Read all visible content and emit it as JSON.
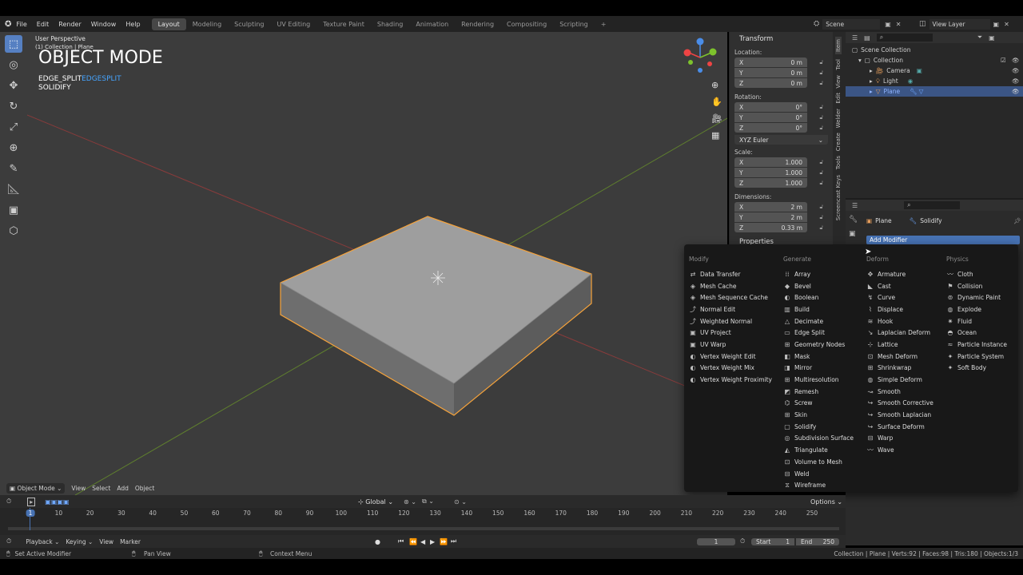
{
  "topbar": {
    "menus": [
      "File",
      "Edit",
      "Render",
      "Window",
      "Help"
    ],
    "workspaces": [
      "Layout",
      "Modeling",
      "Sculpting",
      "UV Editing",
      "Texture Paint",
      "Shading",
      "Animation",
      "Rendering",
      "Compositing",
      "Scripting"
    ],
    "active_workspace": "Layout",
    "add_tab": "+",
    "scene": "Scene",
    "view_layer": "View Layer"
  },
  "viewport": {
    "perspective": "User Perspective",
    "collection_label": "(1) Collection | Plane",
    "mode_overlay": "OBJECT MODE",
    "modifier_line1_a": "EDGE_SPLIT",
    "modifier_line1_b": "EDGESPLIT",
    "modifier_line2": "SOLIDIFY",
    "header": {
      "mode": "Object Mode",
      "view": "View",
      "select": "Select",
      "add": "Add",
      "object": "Object"
    },
    "gizmo": {
      "x": "X",
      "y": "Y",
      "z": "Z"
    }
  },
  "transform_panel": {
    "title": "Transform",
    "location_label": "Location:",
    "location": [
      {
        "axis": "X",
        "value": "0 m"
      },
      {
        "axis": "Y",
        "value": "0 m"
      },
      {
        "axis": "Z",
        "value": "0 m"
      }
    ],
    "rotation_label": "Rotation:",
    "rotation": [
      {
        "axis": "X",
        "value": "0°"
      },
      {
        "axis": "Y",
        "value": "0°"
      },
      {
        "axis": "Z",
        "value": "0°"
      }
    ],
    "rotation_mode": "XYZ Euler",
    "scale_label": "Scale:",
    "scale": [
      {
        "axis": "X",
        "value": "1.000"
      },
      {
        "axis": "Y",
        "value": "1.000"
      },
      {
        "axis": "Z",
        "value": "1.000"
      }
    ],
    "dimensions_label": "Dimensions:",
    "dimensions": [
      {
        "axis": "X",
        "value": "2 m"
      },
      {
        "axis": "Y",
        "value": "2 m"
      },
      {
        "axis": "Z",
        "value": "0.33 m"
      }
    ],
    "properties_label": "Properties"
  },
  "side_tabs": [
    "Item",
    "Tool",
    "View",
    "Edit",
    "Welder",
    "Create",
    "Tools",
    "Screencast Keys"
  ],
  "outliner": {
    "scene_collection": "Scene Collection",
    "collection": "Collection",
    "items": [
      "Camera",
      "Light",
      "Plane"
    ]
  },
  "properties": {
    "object": "Plane",
    "modifier": "Solidify",
    "add_modifier": "Add Modifier"
  },
  "add_modifier_menu": {
    "columns": [
      {
        "header": "Modify",
        "items": [
          "Data Transfer",
          "Mesh Cache",
          "Mesh Sequence Cache",
          "Normal Edit",
          "Weighted Normal",
          "UV Project",
          "UV Warp",
          "Vertex Weight Edit",
          "Vertex Weight Mix",
          "Vertex Weight Proximity"
        ]
      },
      {
        "header": "Generate",
        "items": [
          "Array",
          "Bevel",
          "Boolean",
          "Build",
          "Decimate",
          "Edge Split",
          "Geometry Nodes",
          "Mask",
          "Mirror",
          "Multiresolution",
          "Remesh",
          "Screw",
          "Skin",
          "Solidify",
          "Subdivision Surface",
          "Triangulate",
          "Volume to Mesh",
          "Weld",
          "Wireframe"
        ]
      },
      {
        "header": "Deform",
        "items": [
          "Armature",
          "Cast",
          "Curve",
          "Displace",
          "Hook",
          "Laplacian Deform",
          "Lattice",
          "Mesh Deform",
          "Shrinkwrap",
          "Simple Deform",
          "Smooth",
          "Smooth Corrective",
          "Smooth Laplacian",
          "Surface Deform",
          "Warp",
          "Wave"
        ]
      },
      {
        "header": "Physics",
        "items": [
          "Cloth",
          "Collision",
          "Dynamic Paint",
          "Explode",
          "Fluid",
          "Ocean",
          "Particle Instance",
          "Particle System",
          "Soft Body"
        ]
      }
    ]
  },
  "timeline": {
    "transform_orientation": "Global",
    "options": "Options",
    "ticks": [
      1,
      10,
      20,
      30,
      40,
      50,
      60,
      70,
      80,
      90,
      100,
      110,
      120,
      130,
      140,
      150,
      160,
      170,
      180,
      190,
      200,
      210,
      220,
      230,
      240,
      250
    ],
    "current_frame": "1",
    "playback": "Playback",
    "keying": "Keying",
    "view": "View",
    "marker": "Marker",
    "frame_field": "1",
    "start_label": "Start",
    "start": "1",
    "end_label": "End",
    "end": "250"
  },
  "statusbar": {
    "left": "Set Active Modifier",
    "middle": "Pan View",
    "right_ctx": "Context Menu",
    "stats": "Collection | Plane | Verts:92 | Faces:98 | Tris:180 | Objects:1/3"
  },
  "colors": {
    "accent": "#5680c2",
    "selection": "#f6a33b",
    "x_axis": "#c24545",
    "y_axis": "#6e9a2e"
  }
}
